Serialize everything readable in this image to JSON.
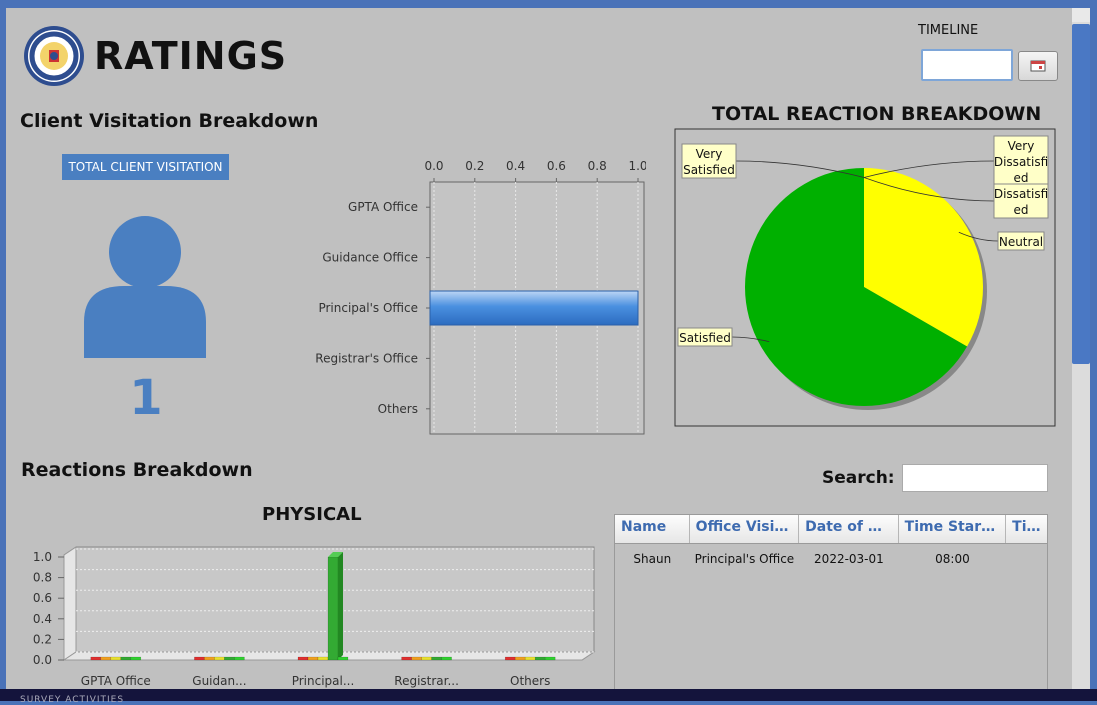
{
  "header": {
    "title": "RATINGS"
  },
  "timeline": {
    "label": "TIMELINE",
    "value": ""
  },
  "client_visitation": {
    "heading": "Client Visitation Breakdown",
    "badge": "TOTAL CLIENT VISITATION",
    "count": "1"
  },
  "reaction_breakdown": {
    "heading": "TOTAL REACTION BREAKDOWN"
  },
  "reactions_section": {
    "heading": "Reactions Breakdown"
  },
  "search": {
    "label": "Search:",
    "value": ""
  },
  "table": {
    "columns": [
      "Name",
      "Office Visit...",
      "Date of Vi...",
      "Time Started",
      "Tim"
    ],
    "rows": [
      [
        "Shaun",
        "Principal's Office",
        "2022-03-01",
        "08:00",
        ""
      ]
    ]
  },
  "footer": {
    "text": "SURVEY ACTIVITIES"
  },
  "colors": {
    "accent": "#4a7fc1",
    "pie_satisfied": "#00b000",
    "pie_neutral": "#ffff00",
    "bar_physical": "#33aa33"
  },
  "chart_data": [
    {
      "type": "bar",
      "orientation": "horizontal",
      "categories": [
        "GPTA Office",
        "Guidance Office",
        "Principal's Office",
        "Registrar's Office",
        "Others"
      ],
      "values": [
        0,
        0,
        1,
        0,
        0
      ],
      "xlim": [
        0,
        1.0
      ],
      "xticks": [
        "0.0",
        "0.2",
        "0.4",
        "0.6",
        "0.8",
        "1.0"
      ],
      "grid": true
    },
    {
      "type": "pie",
      "title": "TOTAL REACTION BREAKDOWN",
      "labels": [
        "Very Satisfied",
        "Very Dissatisfied",
        "Dissatisfied",
        "Neutral",
        "Satisfied"
      ],
      "values": [
        0,
        0,
        0,
        1,
        2
      ],
      "colors": [
        "#ff4040",
        "#ffa000",
        "#ff8080",
        "#ffff00",
        "#00b000"
      ],
      "label_lines": [
        "Very|Satisfied",
        "Very|Dissatisfi|ed",
        "Dissatisfi|ed",
        "Neutral",
        "Satisfied"
      ]
    },
    {
      "type": "bar",
      "title": "PHYSICAL",
      "categories": [
        "GPTA Office",
        "Guidan...",
        "Principal...",
        "Registrar...",
        "Others"
      ],
      "series": [
        {
          "values": [
            0,
            0,
            0,
            0,
            0
          ],
          "color": "#e03030"
        },
        {
          "values": [
            0,
            0,
            0,
            0,
            0
          ],
          "color": "#f0a020"
        },
        {
          "values": [
            0,
            0,
            0,
            0,
            0
          ],
          "color": "#e8e030"
        },
        {
          "values": [
            0,
            0,
            1,
            0,
            0
          ],
          "color": "#33aa33"
        },
        {
          "values": [
            0,
            0,
            0,
            0,
            0
          ],
          "color": "#30d030"
        }
      ],
      "ylim": [
        0,
        1.0
      ],
      "yticks": [
        "0.0",
        "0.2",
        "0.4",
        "0.6",
        "0.8",
        "1.0"
      ],
      "grid": true
    }
  ]
}
